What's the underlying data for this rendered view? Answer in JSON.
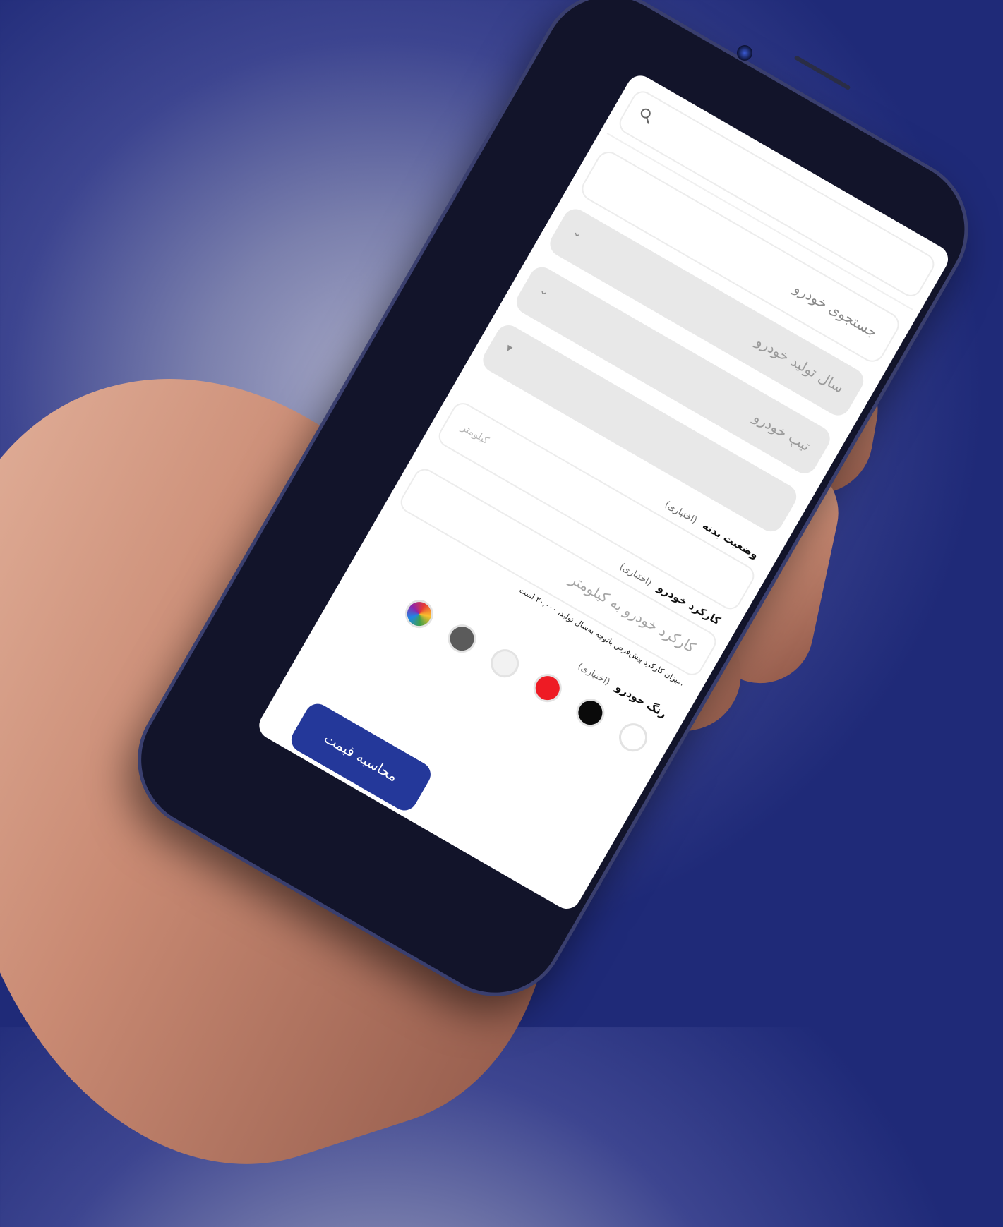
{
  "search": {
    "placeholder": ""
  },
  "fields": {
    "car_search": "جستجوی خودرو",
    "production_year": "سال تولید خودرو",
    "car_trim": "تیپ خودرو"
  },
  "body_condition": {
    "label": "وضعیت بدنه",
    "optional": "(اختیاری)",
    "placeholder": "کیلومتر"
  },
  "mileage": {
    "label": "کارکرد خودرو",
    "optional": "(اختیاری)",
    "placeholder": "کارکرد خودرو به کیلومتر",
    "hint": "میزان کارکرد پیش‌فرض باتوجه به‌سال تولید، ۲۰,۰۰۰ است."
  },
  "color": {
    "label": "رنگ خودرو",
    "optional": "(اختیاری)",
    "swatches": [
      {
        "name": "white",
        "hex": "#ffffff"
      },
      {
        "name": "black",
        "hex": "#0a0a0a"
      },
      {
        "name": "red",
        "hex": "#ee1b24"
      },
      {
        "name": "silver",
        "hex": "#f2f2f2"
      },
      {
        "name": "gray",
        "hex": "#5b5b5b"
      },
      {
        "name": "multicolor",
        "hex": "multi"
      }
    ]
  },
  "actions": {
    "calculate_label": "محاسبه قیمت",
    "accent": "#24389a"
  }
}
